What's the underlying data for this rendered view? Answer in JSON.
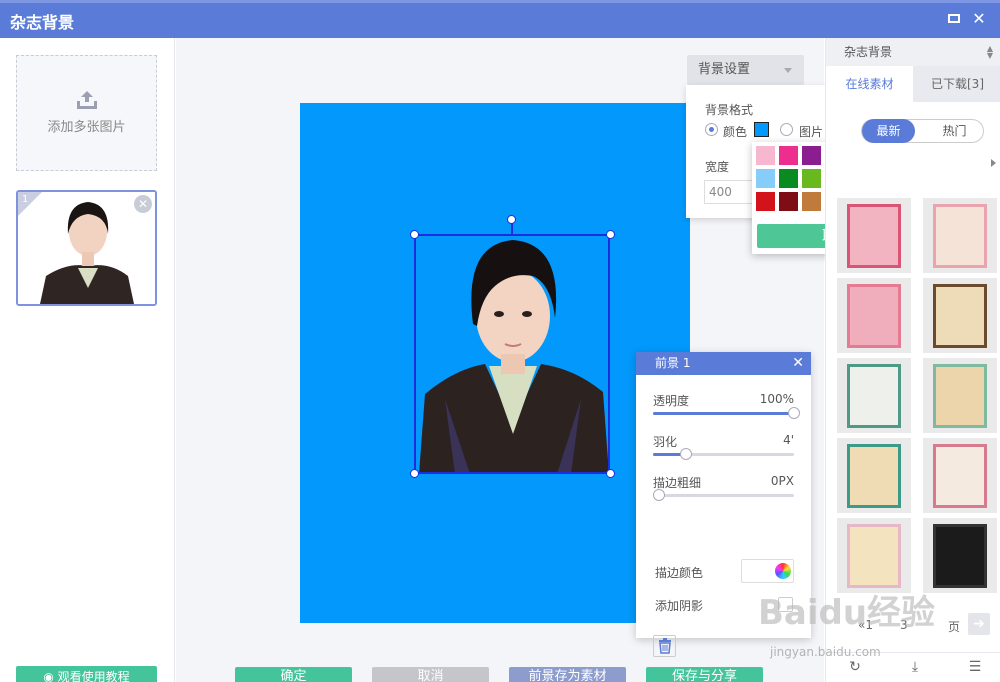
{
  "window": {
    "title": "杂志背景",
    "maximize_icon": "maximize-icon",
    "close_icon": "close-icon"
  },
  "left_panel": {
    "upload_label": "添加多张图片",
    "thumbnail_index": "1",
    "tutorial_button": "观看使用教程"
  },
  "background_settings": {
    "button_label": "背景设置",
    "format_header": "背景格式",
    "option_color": "颜色",
    "option_image": "图片",
    "width_label": "宽度",
    "width_value": "400",
    "selected_color": "#0398fb"
  },
  "palette": {
    "colors": [
      "#f7b8cf",
      "#ee2e8f",
      "#8b1d90",
      "#3d0e73",
      "#0f1f6b",
      "#0d5fbe",
      "#1d9ef0",
      "#86cdfa",
      "#098b1f",
      "#69b81e",
      "#a3d61c",
      "#fbb715",
      "#f25c0c",
      "#f7820b",
      "#d2131b",
      "#7f0d15",
      "#c07b3c",
      "#3a3a3a",
      "#3c4252",
      "#f7f7f7",
      "#272727"
    ],
    "pick_button": "取色"
  },
  "foreground_panel": {
    "title": "前景 1",
    "opacity_label": "透明度",
    "opacity_value": "100%",
    "opacity_fraction": 1.0,
    "feather_label": "羽化",
    "feather_value": "4'",
    "feather_fraction": 0.2,
    "stroke_label": "描边粗细",
    "stroke_value": "0PX",
    "stroke_fraction": 0.0,
    "stroke_color_label": "描边颜色",
    "shadow_label": "添加阴影"
  },
  "bottom_buttons": [
    "确定",
    "取消",
    "前景存为素材",
    "保存与分享"
  ],
  "right_panel": {
    "category": "杂志背景",
    "tabs": [
      "在线素材",
      "已下载[3]"
    ],
    "sort": [
      "最新",
      "热门"
    ],
    "pager": {
      "prev": "«1",
      "current": "3",
      "total": "页"
    }
  },
  "watermark": {
    "main": "Baidu经验",
    "sub": "jingyan.baidu.com"
  }
}
